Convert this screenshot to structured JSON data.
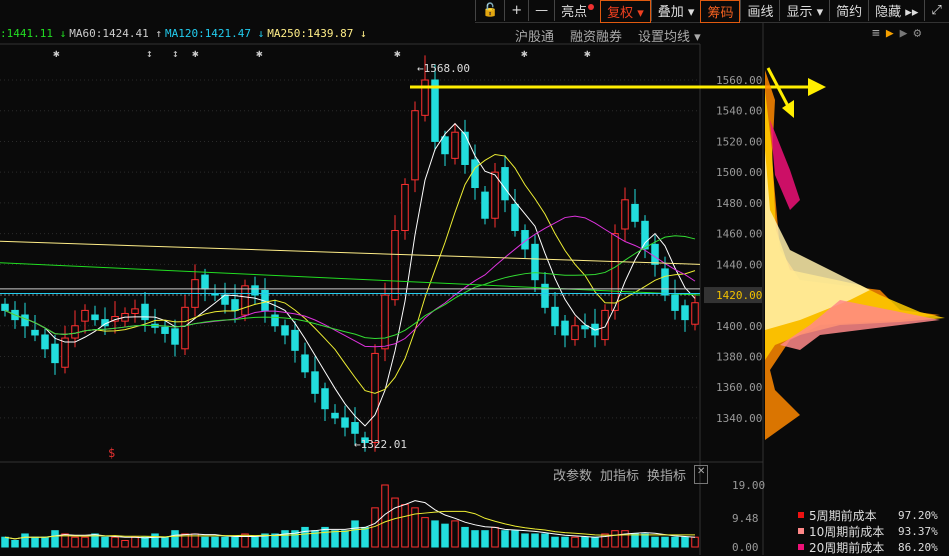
{
  "toolbar": {
    "items": [
      {
        "label": "",
        "icon": "lock-open-icon"
      },
      {
        "label": "+",
        "icon": "zoom-in-icon"
      },
      {
        "label": "—",
        "icon": "zoom-out-icon"
      },
      {
        "label": "亮点"
      },
      {
        "label": "复权 ▾"
      },
      {
        "label": "叠加 ▾"
      },
      {
        "label": "筹码"
      },
      {
        "label": "画线"
      },
      {
        "label": "显示 ▾"
      },
      {
        "label": "简约"
      },
      {
        "label": "隐藏 ▸▸"
      },
      {
        "label": "⤢",
        "icon": "fullscreen-icon"
      }
    ]
  },
  "ma_legend": [
    {
      "text": ":1441.11 ↓",
      "color": "#22dd22"
    },
    {
      "text": "MA60:1424.41 ↑",
      "color": "#cccccc"
    },
    {
      "text": "MA120:1421.47 ↓",
      "color": "#22ccee"
    },
    {
      "text": "MA250:1439.87 ↓",
      "color": "#ffee88"
    }
  ],
  "links": [
    "沪股通",
    "融资融券",
    "设置均线 ▾"
  ],
  "indicator_links": [
    "改参数",
    "加指标",
    "换指标"
  ],
  "price_axis": [
    "1560.00",
    "1540.00",
    "1520.00",
    "1500.00",
    "1480.00",
    "1460.00",
    "1440.00",
    "1420.00",
    "1400.00",
    "1380.00",
    "1360.00",
    "1340.00"
  ],
  "current_price": "1420.00",
  "volume_axis": [
    "19.00",
    "9.48",
    "0.00"
  ],
  "annotations": {
    "high": "1568.00",
    "low": "1322.01",
    "dollar": "$"
  },
  "chip_legend": [
    {
      "label": "5周期前成本",
      "value": "97.20%",
      "color": "#ee1111"
    },
    {
      "label": "10周期前成本",
      "value": "93.37%",
      "color": "#ff8888"
    },
    {
      "label": "20周期前成本",
      "value": "86.20%",
      "color": "#ee1177"
    }
  ],
  "colors": {
    "up": "#ff3030",
    "down": "#22dddd",
    "accent": "#f06020"
  },
  "chart_data": {
    "type": "candlestick",
    "ylim": [
      1310,
      1580
    ],
    "closes": [
      1410,
      1404,
      1400,
      1394,
      1385,
      1376,
      1392,
      1400,
      1410,
      1404,
      1400,
      1406,
      1408,
      1411,
      1404,
      1399,
      1395,
      1388,
      1412,
      1430,
      1424,
      1420,
      1414,
      1410,
      1426,
      1420,
      1410,
      1400,
      1394,
      1384,
      1370,
      1356,
      1346,
      1340,
      1334,
      1330,
      1324,
      1382,
      1420,
      1462,
      1492,
      1540,
      1560,
      1520,
      1512,
      1526,
      1505,
      1490,
      1470,
      1500,
      1482,
      1462,
      1450,
      1430,
      1412,
      1400,
      1394,
      1400,
      1398,
      1394,
      1410,
      1460,
      1482,
      1468,
      1450,
      1440,
      1420,
      1410,
      1404,
      1415
    ],
    "volumes": [
      3,
      2,
      4,
      3,
      3,
      5,
      4,
      3,
      3,
      4,
      3,
      3,
      2,
      3,
      3,
      4,
      3,
      5,
      4,
      4,
      3,
      3,
      3,
      3,
      4,
      3,
      4,
      4,
      5,
      5,
      6,
      5,
      6,
      5,
      5,
      8,
      6,
      12,
      19,
      15,
      13,
      12,
      9,
      8,
      7,
      8,
      6,
      5,
      5,
      6,
      5,
      5,
      4,
      4,
      4,
      3,
      3,
      3,
      3,
      3,
      4,
      5,
      5,
      4,
      4,
      3,
      3,
      3,
      3,
      3
    ]
  }
}
